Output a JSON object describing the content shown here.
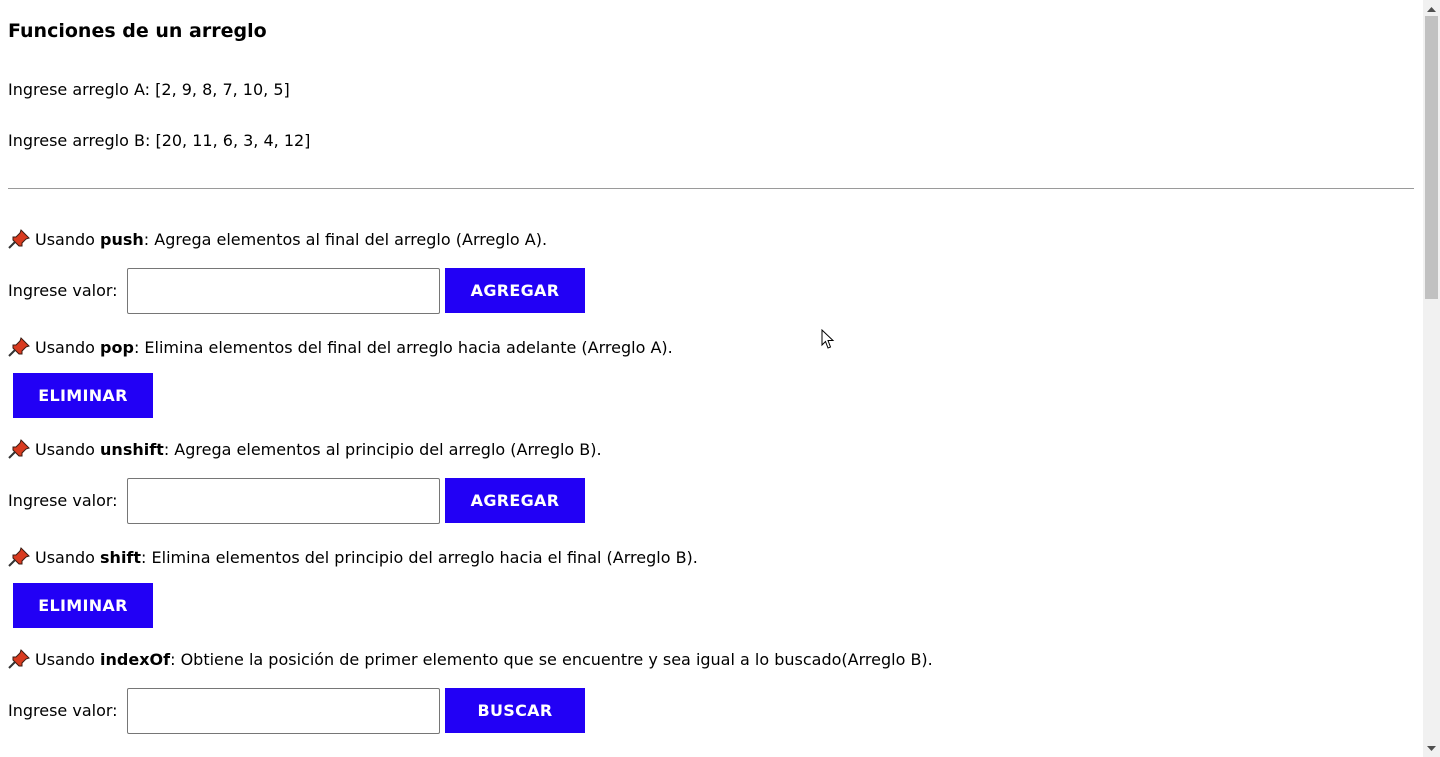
{
  "page": {
    "title": "Funciones de un arreglo",
    "array_a_label": "Ingrese arreglo A: [2, 9, 8, 7, 10, 5]",
    "array_b_label": "Ingrese arreglo B: [20, 11, 6, 3, 4, 12]"
  },
  "sections": [
    {
      "icon": "pushpin-icon",
      "prefix": "Usando ",
      "method": "push",
      "description": ": Agrega elementos al final del arreglo (Arreglo A).",
      "input_label": "Ingrese valor:",
      "input_value": "",
      "button_label": "AGREGAR"
    },
    {
      "icon": "pushpin-icon",
      "prefix": "Usando ",
      "method": "pop",
      "description": ": Elimina elementos del final del arreglo hacia adelante (Arreglo A).",
      "button_label": "ELIMINAR"
    },
    {
      "icon": "pushpin-icon",
      "prefix": "Usando ",
      "method": "unshift",
      "description": ": Agrega elementos al principio del arreglo (Arreglo B).",
      "input_label": "Ingrese valor:",
      "input_value": "",
      "button_label": "AGREGAR"
    },
    {
      "icon": "pushpin-icon",
      "prefix": "Usando ",
      "method": "shift",
      "description": ": Elimina elementos del principio del arreglo hacia el final (Arreglo B).",
      "button_label": "ELIMINAR"
    },
    {
      "icon": "pushpin-icon",
      "prefix": "Usando ",
      "method": "indexOf",
      "description": ": Obtiene la posición de primer elemento que se encuentre y sea igual a lo buscado(Arreglo B).",
      "input_label": "Ingrese valor:",
      "input_value": "",
      "button_label": "BUSCAR"
    }
  ],
  "colors": {
    "button_bg": "#2200f5",
    "button_text": "#ffffff",
    "pin_red": "#d93a1f"
  }
}
